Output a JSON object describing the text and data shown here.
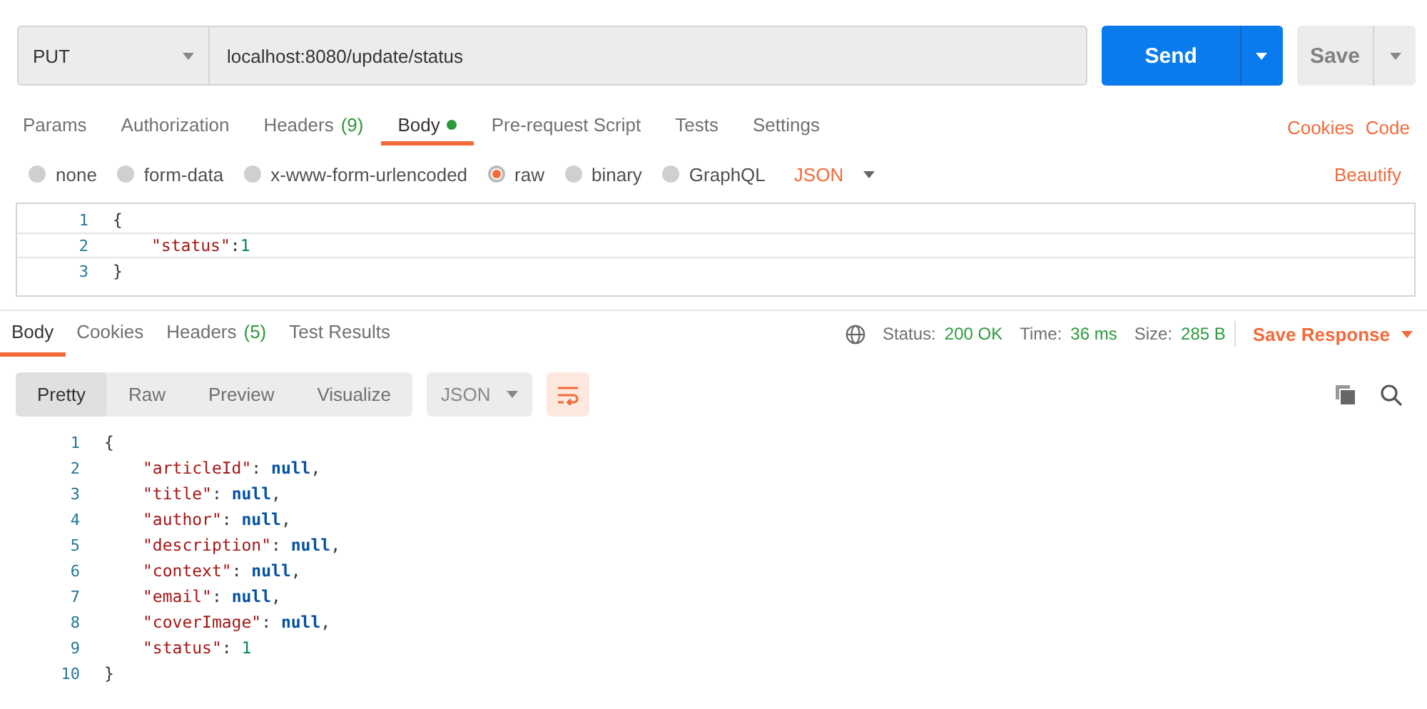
{
  "request_bar": {
    "method": "PUT",
    "url": "localhost:8080/update/status",
    "send": "Send",
    "save": "Save"
  },
  "request_tabs": [
    {
      "label": "Params",
      "selected": false
    },
    {
      "label": "Authorization",
      "selected": false
    },
    {
      "label": "Headers",
      "count": "(9)",
      "selected": false
    },
    {
      "label": "Body",
      "indicator": true,
      "selected": true
    },
    {
      "label": "Pre-request Script",
      "selected": false
    },
    {
      "label": "Tests",
      "selected": false
    },
    {
      "label": "Settings",
      "selected": false
    }
  ],
  "request_links": [
    "Cookies",
    "Code"
  ],
  "body_types": [
    {
      "label": "none",
      "selected": false
    },
    {
      "label": "form-data",
      "selected": false
    },
    {
      "label": "x-www-form-urlencoded",
      "selected": false
    },
    {
      "label": "raw",
      "selected": true
    },
    {
      "label": "binary",
      "selected": false
    },
    {
      "label": "GraphQL",
      "selected": false
    }
  ],
  "body_format": "JSON",
  "beautify": "Beautify",
  "request_body": [
    {
      "number": "1",
      "tokens": [
        {
          "kind": "punct",
          "text": "{"
        }
      ]
    },
    {
      "number": "2",
      "tokens": [
        {
          "kind": "key",
          "text": "\"status\""
        },
        {
          "kind": "punct",
          "text": ":"
        },
        {
          "kind": "number",
          "text": "1"
        }
      ]
    },
    {
      "number": "3",
      "tokens": [
        {
          "kind": "punct",
          "text": "}"
        }
      ]
    }
  ],
  "response_tabs": [
    {
      "label": "Body",
      "selected": true
    },
    {
      "label": "Cookies",
      "selected": false
    },
    {
      "label": "Headers",
      "count": "(5)",
      "selected": false
    },
    {
      "label": "Test Results",
      "selected": false
    }
  ],
  "response_meta": [
    {
      "label": "Status:",
      "value": "200 OK"
    },
    {
      "label": "Time:",
      "value": "36 ms"
    },
    {
      "label": "Size:",
      "value": "285 B"
    }
  ],
  "save_response": "Save Response",
  "view_modes": [
    {
      "label": "Pretty",
      "selected": true
    },
    {
      "label": "Raw",
      "selected": false
    },
    {
      "label": "Preview",
      "selected": false
    },
    {
      "label": "Visualize",
      "selected": false
    }
  ],
  "response_format": "JSON",
  "wrap_on": true,
  "response_body": [
    {
      "number": "1",
      "tokens": [
        {
          "kind": "punct",
          "text": "{"
        }
      ]
    },
    {
      "number": "2",
      "tokens": [
        {
          "kind": "key",
          "text": "\"articleId\""
        },
        {
          "kind": "punct",
          "text": ": "
        },
        {
          "kind": "null",
          "text": "null"
        },
        {
          "kind": "punct",
          "text": ","
        }
      ]
    },
    {
      "number": "3",
      "tokens": [
        {
          "kind": "key",
          "text": "\"title\""
        },
        {
          "kind": "punct",
          "text": ": "
        },
        {
          "kind": "null",
          "text": "null"
        },
        {
          "kind": "punct",
          "text": ","
        }
      ]
    },
    {
      "number": "4",
      "tokens": [
        {
          "kind": "key",
          "text": "\"author\""
        },
        {
          "kind": "punct",
          "text": ": "
        },
        {
          "kind": "null",
          "text": "null"
        },
        {
          "kind": "punct",
          "text": ","
        }
      ]
    },
    {
      "number": "5",
      "tokens": [
        {
          "kind": "key",
          "text": "\"description\""
        },
        {
          "kind": "punct",
          "text": ": "
        },
        {
          "kind": "null",
          "text": "null"
        },
        {
          "kind": "punct",
          "text": ","
        }
      ]
    },
    {
      "number": "6",
      "tokens": [
        {
          "kind": "key",
          "text": "\"context\""
        },
        {
          "kind": "punct",
          "text": ": "
        },
        {
          "kind": "null",
          "text": "null"
        },
        {
          "kind": "punct",
          "text": ","
        }
      ]
    },
    {
      "number": "7",
      "tokens": [
        {
          "kind": "key",
          "text": "\"email\""
        },
        {
          "kind": "punct",
          "text": ": "
        },
        {
          "kind": "null",
          "text": "null"
        },
        {
          "kind": "punct",
          "text": ","
        }
      ]
    },
    {
      "number": "8",
      "tokens": [
        {
          "kind": "key",
          "text": "\"coverImage\""
        },
        {
          "kind": "punct",
          "text": ": "
        },
        {
          "kind": "null",
          "text": "null"
        },
        {
          "kind": "punct",
          "text": ","
        }
      ]
    },
    {
      "number": "9",
      "tokens": [
        {
          "kind": "key",
          "text": "\"status\""
        },
        {
          "kind": "punct",
          "text": ": "
        },
        {
          "kind": "number",
          "text": "1"
        }
      ]
    },
    {
      "number": "10",
      "tokens": [
        {
          "kind": "punct",
          "text": "}"
        }
      ]
    }
  ]
}
